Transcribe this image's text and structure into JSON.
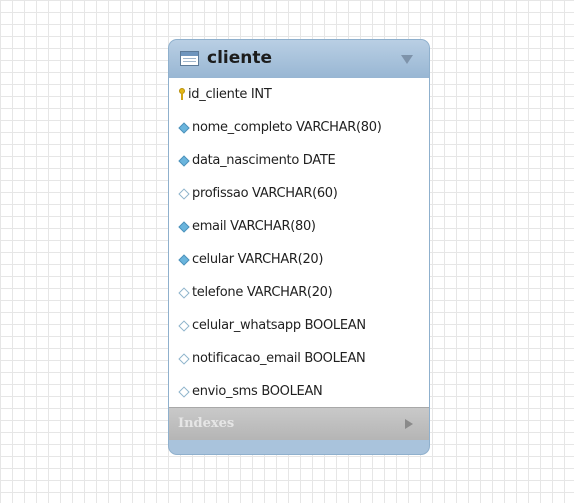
{
  "table": {
    "name": "cliente",
    "header_color": "#a9c3dc",
    "columns": [
      {
        "label": "id_cliente INT",
        "icon": "primary-key-icon"
      },
      {
        "label": "nome_completo VARCHAR(80)",
        "icon": "not-null-column-icon"
      },
      {
        "label": "data_nascimento DATE",
        "icon": "not-null-column-icon"
      },
      {
        "label": "profissao VARCHAR(60)",
        "icon": "nullable-column-icon"
      },
      {
        "label": "email VARCHAR(80)",
        "icon": "not-null-column-icon"
      },
      {
        "label": "celular VARCHAR(20)",
        "icon": "not-null-column-icon"
      },
      {
        "label": "telefone VARCHAR(20)",
        "icon": "nullable-column-icon"
      },
      {
        "label": "celular_whatsapp BOOLEAN",
        "icon": "nullable-column-icon"
      },
      {
        "label": "notificacao_email BOOLEAN",
        "icon": "nullable-column-icon"
      },
      {
        "label": "envio_sms BOOLEAN",
        "icon": "nullable-column-icon"
      }
    ],
    "indexes_label": "Indexes"
  }
}
